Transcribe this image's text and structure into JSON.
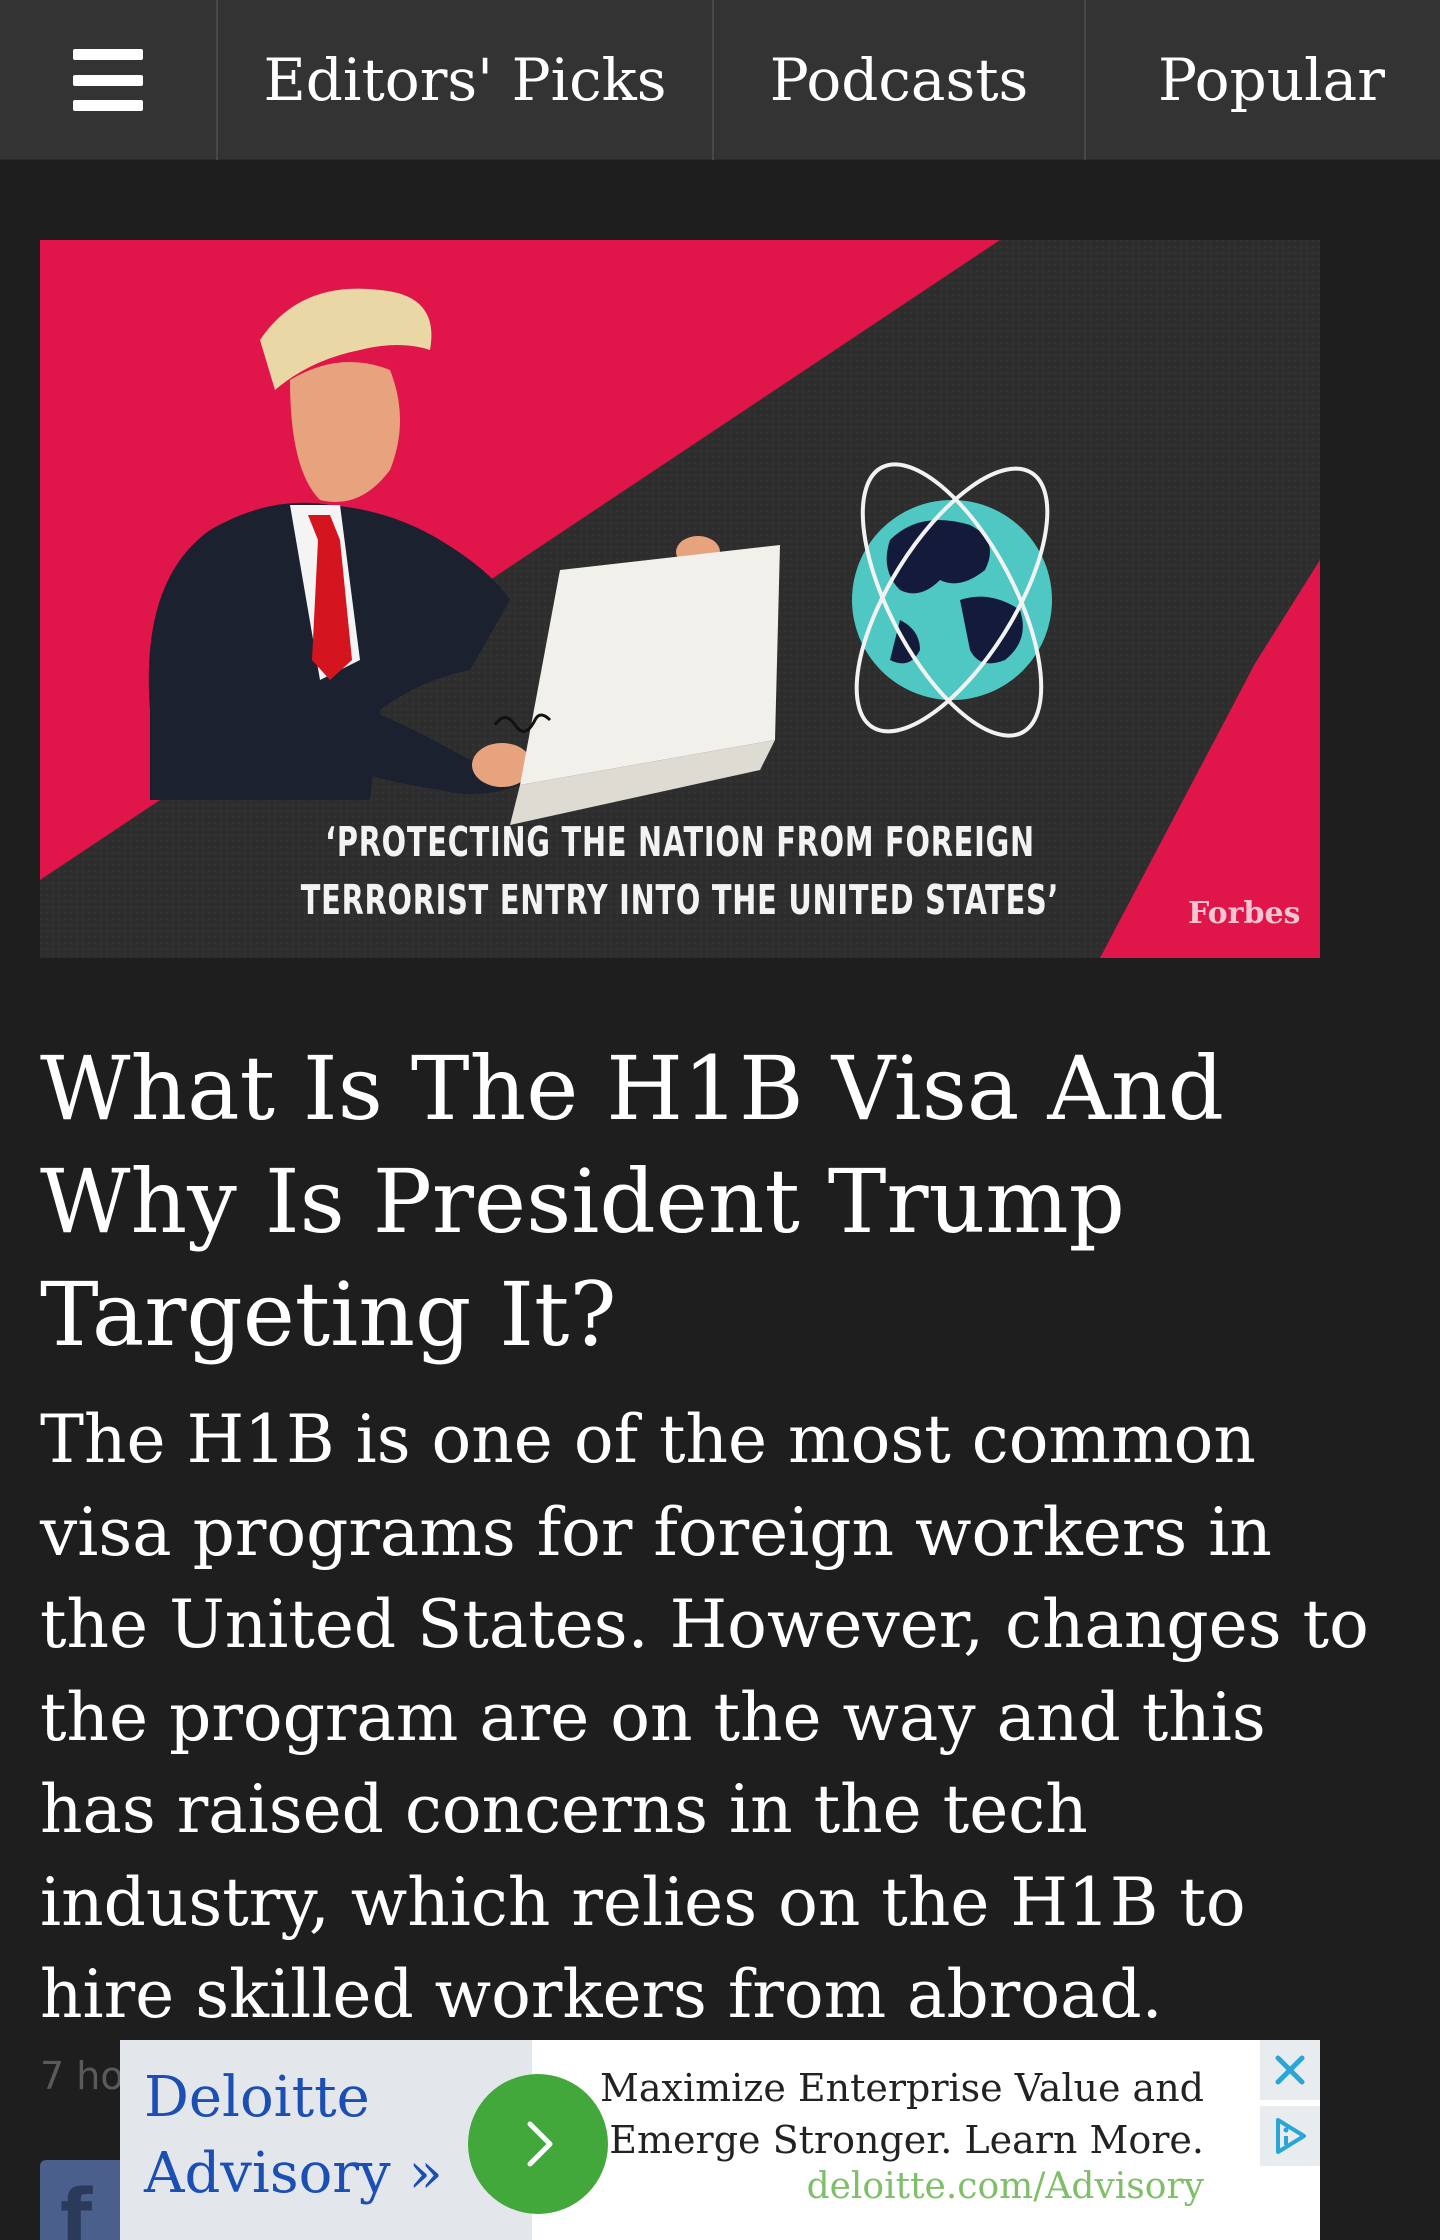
{
  "nav": {
    "menu_icon": "hamburger-menu-icon",
    "tabs": [
      {
        "label": "Editors' Picks"
      },
      {
        "label": "Podcasts"
      },
      {
        "label": "Popular"
      }
    ]
  },
  "hero": {
    "caption_line1": "‘PROTECTING THE NATION FROM FOREIGN",
    "caption_line2": "TERRORIST ENTRY INTO THE UNITED STATES’",
    "brand": "Forbes",
    "colors": {
      "pink": "#e0154a",
      "dark": "#2f2f2f",
      "globe": "#4fc7c3"
    }
  },
  "article": {
    "headline": "What Is The H1B Visa And Why Is President Trump Targeting It?",
    "summary": "The H1B is one of the most common visa programs for foreign workers in the United States. However, changes to the program are on the way and this has raised concerns in the tech industry, which relies on the H1B to hire skilled workers from abroad.",
    "timestamp": "7 ho"
  },
  "share": {
    "facebook_icon": "facebook-icon"
  },
  "ad": {
    "brand": "Deloitte Advisory »",
    "copy_line1": "Maximize Enterprise Value and",
    "copy_line2": "Emerge Stronger. Learn More.",
    "url": "deloitte.com/Advisory",
    "accent_color": "#43a83c"
  }
}
